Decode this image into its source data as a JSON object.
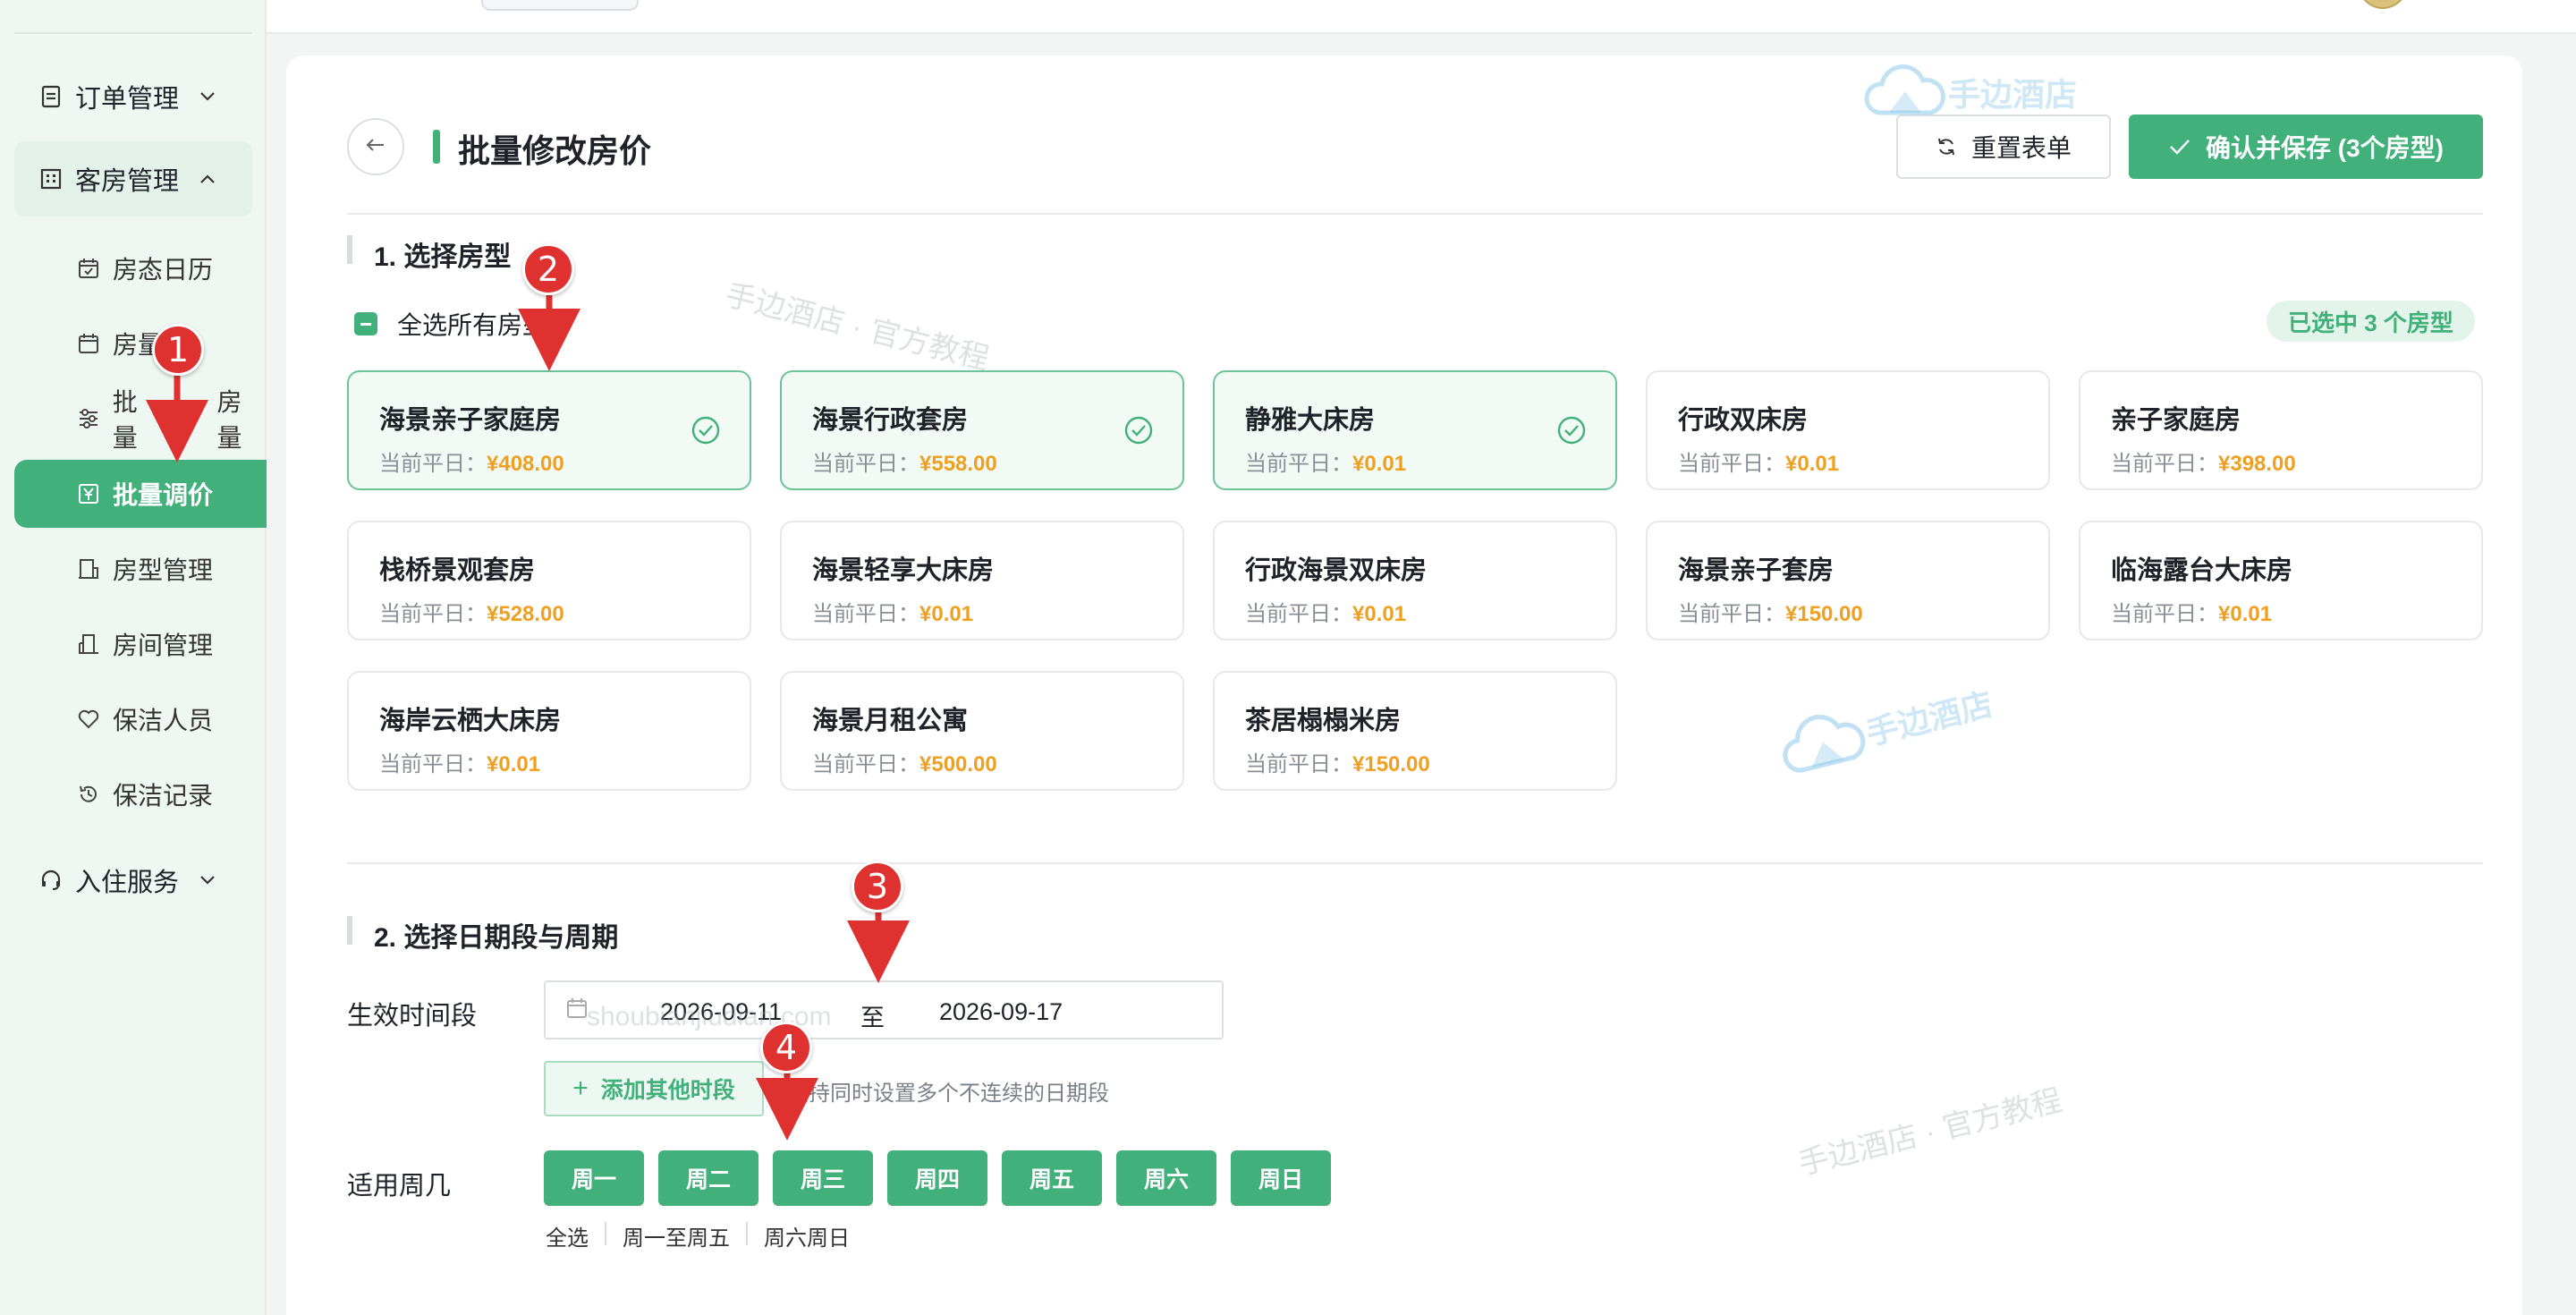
{
  "sidebar": {
    "groups": [
      {
        "label": "订单管理"
      },
      {
        "label": "客房管理"
      },
      {
        "label": "入住服务"
      }
    ],
    "sub_items": [
      {
        "label": "房态日历"
      },
      {
        "label": "房量"
      },
      {
        "label": "批量"
      },
      {
        "label": "房量"
      },
      {
        "label": "批量调价"
      },
      {
        "label": "房型管理"
      },
      {
        "label": "房间管理"
      },
      {
        "label": "保洁人员"
      },
      {
        "label": "保洁记录"
      }
    ]
  },
  "header": {
    "title": "批量修改房价",
    "reset_label": "重置表单",
    "save_label": "确认并保存 (3个房型)"
  },
  "section1": {
    "title": "1. 选择房型",
    "select_all_label": "全选所有房型",
    "selected_badge": "已选中 3 个房型",
    "price_prefix": "当前平日：",
    "rooms": [
      {
        "name": "海景亲子家庭房",
        "price": "¥408.00",
        "selected": true
      },
      {
        "name": "海景行政套房",
        "price": "¥558.00",
        "selected": true
      },
      {
        "name": "静雅大床房",
        "price": "¥0.01",
        "selected": true
      },
      {
        "name": "行政双床房",
        "price": "¥0.01",
        "selected": false
      },
      {
        "name": "亲子家庭房",
        "price": "¥398.00",
        "selected": false
      },
      {
        "name": "栈桥景观套房",
        "price": "¥528.00",
        "selected": false
      },
      {
        "name": "海景轻享大床房",
        "price": "¥0.01",
        "selected": false
      },
      {
        "name": "行政海景双床房",
        "price": "¥0.01",
        "selected": false
      },
      {
        "name": "海景亲子套房",
        "price": "¥150.00",
        "selected": false
      },
      {
        "name": "临海露台大床房",
        "price": "¥0.01",
        "selected": false
      },
      {
        "name": "海岸云栖大床房",
        "price": "¥0.01",
        "selected": false
      },
      {
        "name": "海景月租公寓",
        "price": "¥500.00",
        "selected": false
      },
      {
        "name": "茶居榻榻米房",
        "price": "¥150.00",
        "selected": false
      }
    ]
  },
  "section2": {
    "title": "2. 选择日期段与周期",
    "period_label": "生效时间段",
    "date_start": "2026-09-11",
    "date_sep": "至",
    "date_end": "2026-09-17",
    "add_period_label": "添加其他时段",
    "add_period_hint": "支持同时设置多个不连续的日期段",
    "weekday_label": "适用周几",
    "weekdays": [
      "周一",
      "周二",
      "周三",
      "周四",
      "周五",
      "周六",
      "周日"
    ],
    "quick_select": [
      "全选",
      "周一至周五",
      "周六周日"
    ]
  },
  "annotations": [
    "1",
    "2",
    "3",
    "4"
  ],
  "watermarks": {
    "brand": "手边酒店",
    "tutorial": "手边酒店 · 官方教程",
    "domain": "shoubianjiudian.com"
  },
  "colors": {
    "accent": "#41b07b",
    "price": "#f0a020",
    "marker": "#e03131"
  }
}
